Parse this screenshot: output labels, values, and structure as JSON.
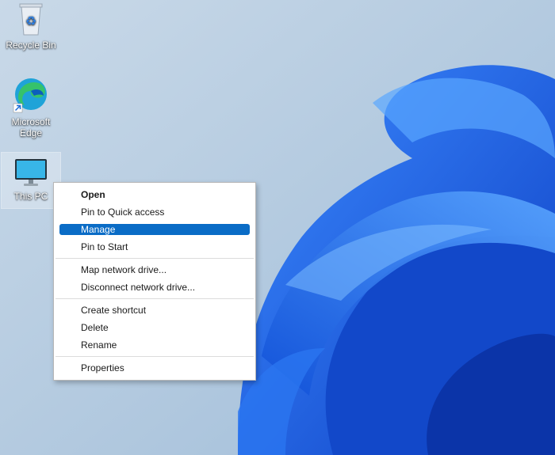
{
  "desktop": {
    "icons": [
      {
        "label": "Recycle Bin",
        "icon": "recycle-bin-icon"
      },
      {
        "label": "Microsoft Edge",
        "icon": "edge-icon"
      },
      {
        "label": "This PC",
        "icon": "monitor-icon"
      }
    ]
  },
  "context_menu": {
    "groups": [
      [
        {
          "label": "Open",
          "bold": true
        },
        {
          "label": "Pin to Quick access"
        },
        {
          "label": "Manage",
          "highlighted": true
        },
        {
          "label": "Pin to Start"
        }
      ],
      [
        {
          "label": "Map network drive..."
        },
        {
          "label": "Disconnect network drive..."
        }
      ],
      [
        {
          "label": "Create shortcut"
        },
        {
          "label": "Delete"
        },
        {
          "label": "Rename"
        }
      ],
      [
        {
          "label": "Properties"
        }
      ]
    ]
  },
  "colors": {
    "highlight": "#0a6cc6",
    "wallpaper_base": "#b9cfe2",
    "bloom": "#1e5fe6"
  }
}
